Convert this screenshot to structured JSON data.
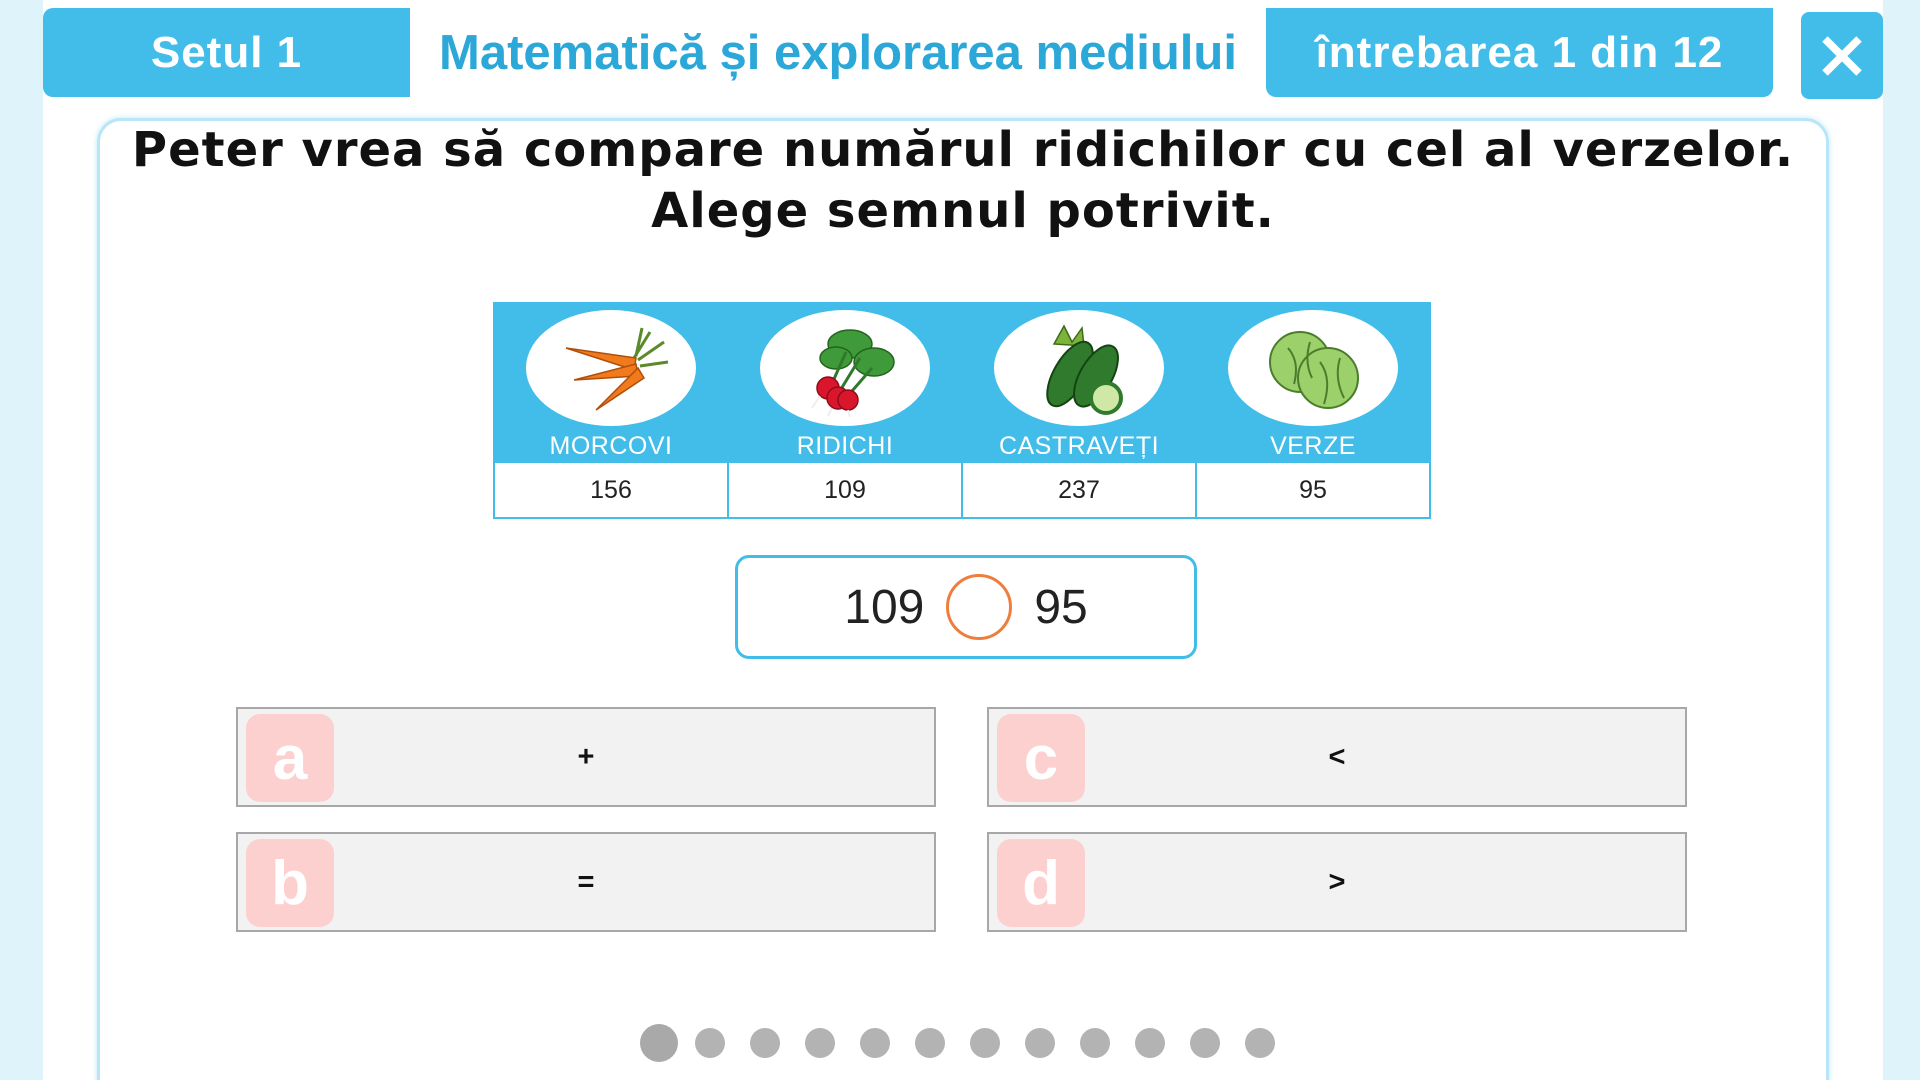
{
  "header": {
    "set_label": "Setul 1",
    "subject": "Matematică și explorarea mediului",
    "question_counter": "întrebarea 1 din 12",
    "close_icon": "close-icon"
  },
  "question": {
    "line1": "Peter vrea să compare numărul ridichilor cu cel al verzelor.",
    "line2": "Alege semnul potrivit."
  },
  "table": {
    "items": [
      {
        "label": "MORCOVI",
        "value": "156",
        "icon": "carrot-icon"
      },
      {
        "label": "RIDICHI",
        "value": "109",
        "icon": "radish-icon"
      },
      {
        "label": "CASTRAVEȚI",
        "value": "237",
        "icon": "cucumber-icon"
      },
      {
        "label": "VERZE",
        "value": "95",
        "icon": "cabbage-icon"
      }
    ]
  },
  "comparison": {
    "left": "109",
    "right": "95"
  },
  "options": [
    {
      "letter": "a",
      "symbol": "+"
    },
    {
      "letter": "b",
      "symbol": "="
    },
    {
      "letter": "c",
      "symbol": "<"
    },
    {
      "letter": "d",
      "symbol": ">"
    }
  ],
  "progress": {
    "total_questions": 12,
    "current_question": 1
  },
  "colors": {
    "accent": "#42bde9",
    "subject_text": "#2ba7d8",
    "option_letter_bg": "#fdd0d0",
    "compare_circle": "#ef7d3c"
  }
}
